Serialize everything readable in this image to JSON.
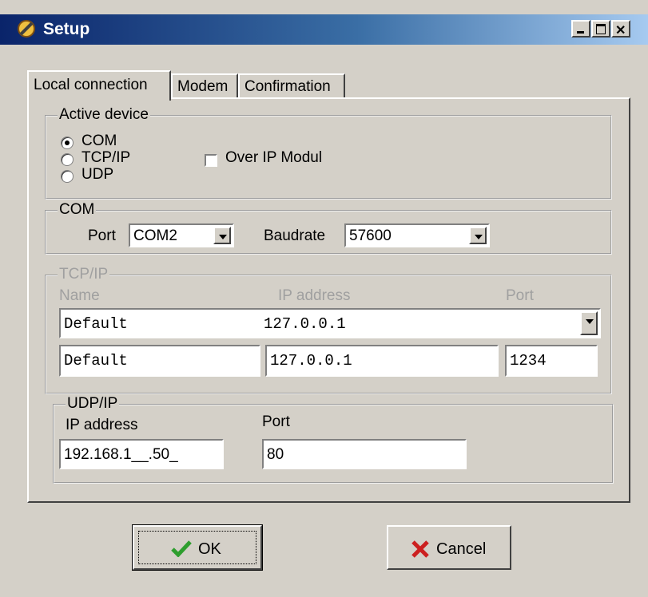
{
  "window": {
    "title": "Setup"
  },
  "tabs": [
    {
      "label": "Local connection",
      "active": true
    },
    {
      "label": "Modem",
      "active": false
    },
    {
      "label": "Confirmation",
      "active": false
    }
  ],
  "active_device": {
    "legend": "Active device",
    "options": [
      {
        "label": "COM",
        "selected": true
      },
      {
        "label": "TCP/IP",
        "selected": false
      },
      {
        "label": "UDP",
        "selected": false
      }
    ],
    "over_ip": {
      "label": "Over IP Modul",
      "checked": false
    }
  },
  "com": {
    "legend": "COM",
    "port_label": "Port",
    "port_value": "COM2",
    "baud_label": "Baudrate",
    "baud_value": "57600"
  },
  "tcpip": {
    "legend": "TCP/IP",
    "col_name": "Name",
    "col_ip": "IP address",
    "col_port": "Port",
    "combo_name": "Default",
    "combo_ip": "127.0.0.1",
    "name_value": "Default",
    "ip_value": "127.0.0.1",
    "port_value": "1234"
  },
  "udp": {
    "legend": "UDP/IP",
    "ip_label": "IP address",
    "port_label": "Port",
    "ip_value": "192.168.1__.50_",
    "port_value": "80"
  },
  "buttons": {
    "ok": "OK",
    "cancel": "Cancel"
  },
  "colors": {
    "titlebar_start": "#0a246a",
    "titlebar_end": "#a6caf0",
    "face": "#d4d0c8",
    "ok_check": "#2e9e2e",
    "cancel_x": "#cc2020"
  }
}
